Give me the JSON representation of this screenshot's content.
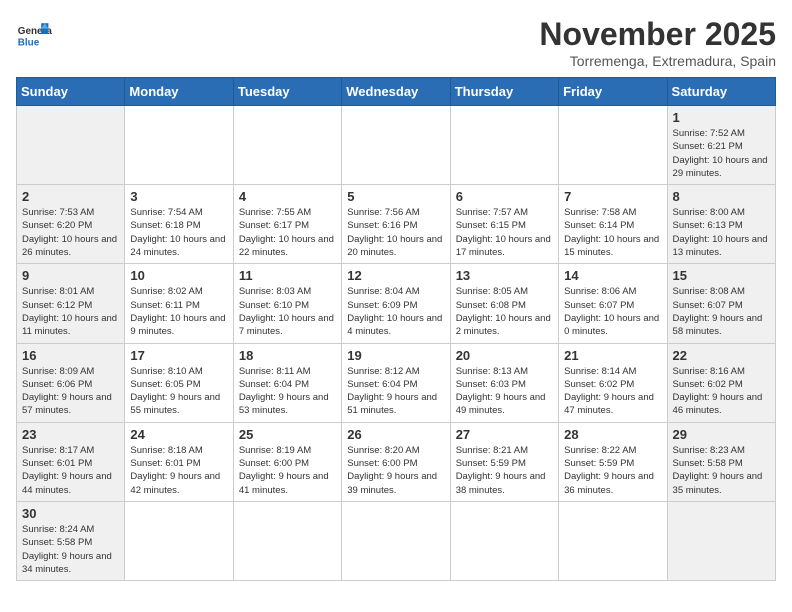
{
  "header": {
    "logo_general": "General",
    "logo_blue": "Blue",
    "title": "November 2025",
    "subtitle": "Torremenga, Extremadura, Spain"
  },
  "weekdays": [
    "Sunday",
    "Monday",
    "Tuesday",
    "Wednesday",
    "Thursday",
    "Friday",
    "Saturday"
  ],
  "weeks": [
    [
      {
        "day": "",
        "info": ""
      },
      {
        "day": "",
        "info": ""
      },
      {
        "day": "",
        "info": ""
      },
      {
        "day": "",
        "info": ""
      },
      {
        "day": "",
        "info": ""
      },
      {
        "day": "",
        "info": ""
      },
      {
        "day": "1",
        "info": "Sunrise: 7:52 AM\nSunset: 6:21 PM\nDaylight: 10 hours and 29 minutes."
      }
    ],
    [
      {
        "day": "2",
        "info": "Sunrise: 7:53 AM\nSunset: 6:20 PM\nDaylight: 10 hours and 26 minutes."
      },
      {
        "day": "3",
        "info": "Sunrise: 7:54 AM\nSunset: 6:18 PM\nDaylight: 10 hours and 24 minutes."
      },
      {
        "day": "4",
        "info": "Sunrise: 7:55 AM\nSunset: 6:17 PM\nDaylight: 10 hours and 22 minutes."
      },
      {
        "day": "5",
        "info": "Sunrise: 7:56 AM\nSunset: 6:16 PM\nDaylight: 10 hours and 20 minutes."
      },
      {
        "day": "6",
        "info": "Sunrise: 7:57 AM\nSunset: 6:15 PM\nDaylight: 10 hours and 17 minutes."
      },
      {
        "day": "7",
        "info": "Sunrise: 7:58 AM\nSunset: 6:14 PM\nDaylight: 10 hours and 15 minutes."
      },
      {
        "day": "8",
        "info": "Sunrise: 8:00 AM\nSunset: 6:13 PM\nDaylight: 10 hours and 13 minutes."
      }
    ],
    [
      {
        "day": "9",
        "info": "Sunrise: 8:01 AM\nSunset: 6:12 PM\nDaylight: 10 hours and 11 minutes."
      },
      {
        "day": "10",
        "info": "Sunrise: 8:02 AM\nSunset: 6:11 PM\nDaylight: 10 hours and 9 minutes."
      },
      {
        "day": "11",
        "info": "Sunrise: 8:03 AM\nSunset: 6:10 PM\nDaylight: 10 hours and 7 minutes."
      },
      {
        "day": "12",
        "info": "Sunrise: 8:04 AM\nSunset: 6:09 PM\nDaylight: 10 hours and 4 minutes."
      },
      {
        "day": "13",
        "info": "Sunrise: 8:05 AM\nSunset: 6:08 PM\nDaylight: 10 hours and 2 minutes."
      },
      {
        "day": "14",
        "info": "Sunrise: 8:06 AM\nSunset: 6:07 PM\nDaylight: 10 hours and 0 minutes."
      },
      {
        "day": "15",
        "info": "Sunrise: 8:08 AM\nSunset: 6:07 PM\nDaylight: 9 hours and 58 minutes."
      }
    ],
    [
      {
        "day": "16",
        "info": "Sunrise: 8:09 AM\nSunset: 6:06 PM\nDaylight: 9 hours and 57 minutes."
      },
      {
        "day": "17",
        "info": "Sunrise: 8:10 AM\nSunset: 6:05 PM\nDaylight: 9 hours and 55 minutes."
      },
      {
        "day": "18",
        "info": "Sunrise: 8:11 AM\nSunset: 6:04 PM\nDaylight: 9 hours and 53 minutes."
      },
      {
        "day": "19",
        "info": "Sunrise: 8:12 AM\nSunset: 6:04 PM\nDaylight: 9 hours and 51 minutes."
      },
      {
        "day": "20",
        "info": "Sunrise: 8:13 AM\nSunset: 6:03 PM\nDaylight: 9 hours and 49 minutes."
      },
      {
        "day": "21",
        "info": "Sunrise: 8:14 AM\nSunset: 6:02 PM\nDaylight: 9 hours and 47 minutes."
      },
      {
        "day": "22",
        "info": "Sunrise: 8:16 AM\nSunset: 6:02 PM\nDaylight: 9 hours and 46 minutes."
      }
    ],
    [
      {
        "day": "23",
        "info": "Sunrise: 8:17 AM\nSunset: 6:01 PM\nDaylight: 9 hours and 44 minutes."
      },
      {
        "day": "24",
        "info": "Sunrise: 8:18 AM\nSunset: 6:01 PM\nDaylight: 9 hours and 42 minutes."
      },
      {
        "day": "25",
        "info": "Sunrise: 8:19 AM\nSunset: 6:00 PM\nDaylight: 9 hours and 41 minutes."
      },
      {
        "day": "26",
        "info": "Sunrise: 8:20 AM\nSunset: 6:00 PM\nDaylight: 9 hours and 39 minutes."
      },
      {
        "day": "27",
        "info": "Sunrise: 8:21 AM\nSunset: 5:59 PM\nDaylight: 9 hours and 38 minutes."
      },
      {
        "day": "28",
        "info": "Sunrise: 8:22 AM\nSunset: 5:59 PM\nDaylight: 9 hours and 36 minutes."
      },
      {
        "day": "29",
        "info": "Sunrise: 8:23 AM\nSunset: 5:58 PM\nDaylight: 9 hours and 35 minutes."
      }
    ],
    [
      {
        "day": "30",
        "info": "Sunrise: 8:24 AM\nSunset: 5:58 PM\nDaylight: 9 hours and 34 minutes."
      },
      {
        "day": "",
        "info": ""
      },
      {
        "day": "",
        "info": ""
      },
      {
        "day": "",
        "info": ""
      },
      {
        "day": "",
        "info": ""
      },
      {
        "day": "",
        "info": ""
      },
      {
        "day": "",
        "info": ""
      }
    ]
  ]
}
